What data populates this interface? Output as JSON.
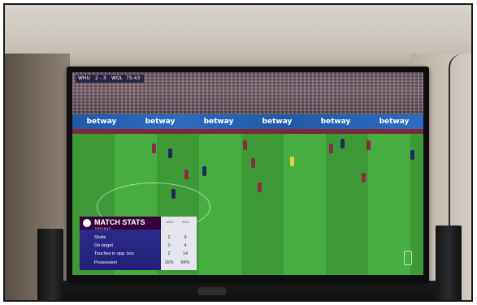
{
  "scene": {
    "description_colors": {
      "pitch": "#3fa23a",
      "graphic_purple": "#38003c",
      "graphic_blue": "#2c2a8a"
    }
  },
  "broadcast": {
    "adboards": [
      "betway",
      "betway",
      "betway",
      "betway",
      "betway",
      "betway"
    ],
    "scoreline": {
      "home": "WHU",
      "score": "2 - 3",
      "away": "WOL",
      "clock": "75:43"
    }
  },
  "match_stats": {
    "title": "MATCH STATS",
    "subtitle": "THIS HALF",
    "columns": [
      "WHU",
      "WOL"
    ],
    "rows": [
      {
        "label": "Shots",
        "home": "2",
        "away": "9"
      },
      {
        "label": "On target",
        "home": "0",
        "away": "4"
      },
      {
        "label": "Touches in opp. box",
        "home": "2",
        "away": "14"
      },
      {
        "label": "Possession",
        "home": "16%",
        "away": "84%"
      }
    ]
  }
}
